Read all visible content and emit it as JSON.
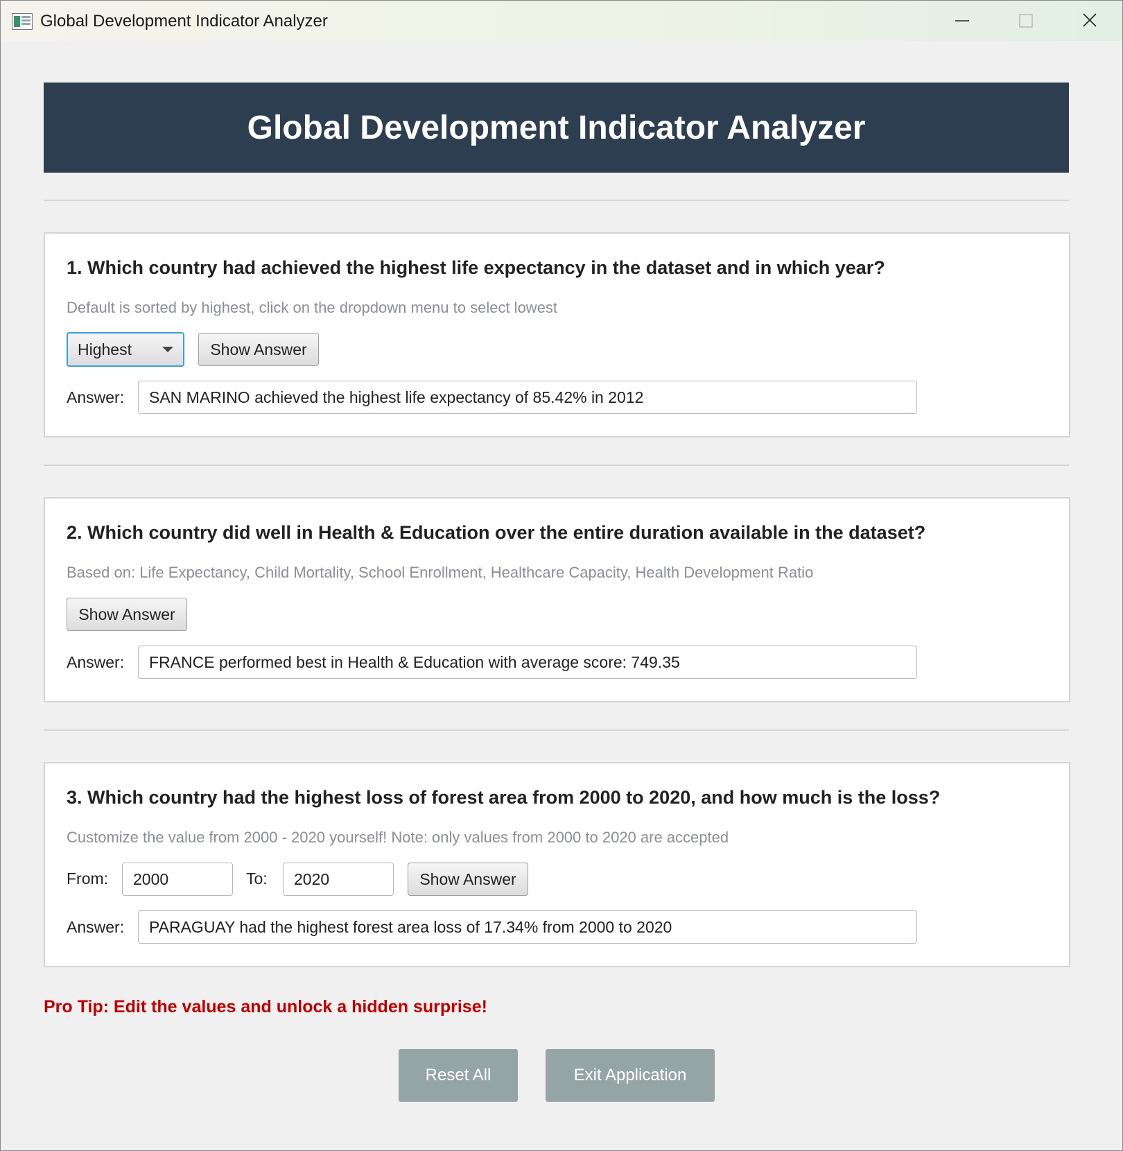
{
  "window": {
    "title": "Global Development Indicator Analyzer",
    "icon": "app-window-icon"
  },
  "header": {
    "title": "Global Development Indicator Analyzer",
    "background": "#2c3e50"
  },
  "q1": {
    "title": "1. Which country had achieved the highest life expectancy in the dataset and in which year?",
    "description": "Default is sorted by highest, click on the dropdown menu to select lowest",
    "sort_select": {
      "value": "Highest"
    },
    "show_label": "Show Answer",
    "answer_label": "Answer:",
    "answer": "SAN MARINO achieved the highest life expectancy of 85.42% in 2012"
  },
  "q2": {
    "title": "2. Which country did well in Health & Education over the entire duration available in the dataset?",
    "description": "Based on: Life Expectancy, Child Mortality, School Enrollment, Healthcare Capacity, Health Development Ratio",
    "show_label": "Show Answer",
    "answer_label": "Answer:",
    "answer": "FRANCE performed best in Health & Education with average score: 749.35"
  },
  "q3": {
    "title": "3. Which country had the highest loss of forest area from 2000 to 2020, and how much is the loss?",
    "description": "Customize the value from 2000 - 2020 yourself! Note: only values from 2000 to 2020 are accepted",
    "from_label": "From:",
    "from_value": "2000",
    "to_label": "To:",
    "to_value": "2020",
    "show_label": "Show Answer",
    "answer_label": "Answer:",
    "answer": "PARAGUAY had the highest forest area loss of 17.34% from 2000 to 2020"
  },
  "protip": {
    "text": "Pro Tip: Edit the values and unlock a hidden surprise!",
    "color": "#c00000"
  },
  "actions": {
    "reset_label": "Reset All",
    "exit_label": "Exit Application",
    "color": "#95a5a6"
  }
}
